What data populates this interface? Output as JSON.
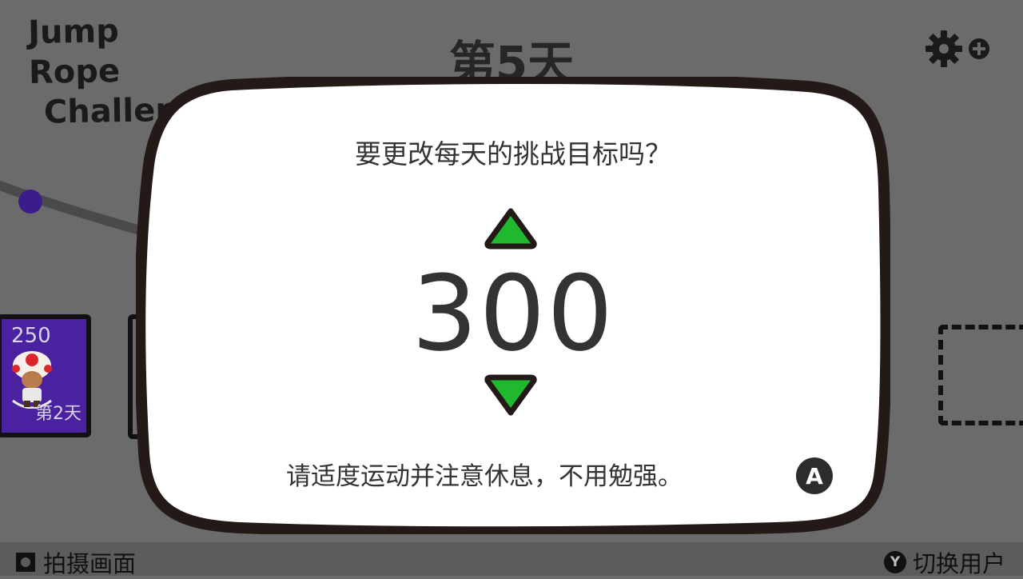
{
  "header": {
    "logo_line1": "Jump Rope",
    "logo_line2": "Challenge",
    "day_title": "第5天"
  },
  "icons": {
    "settings": "gear-icon",
    "add": "plus-circle-icon"
  },
  "cards": {
    "completed": {
      "count": "250",
      "label": "第2天"
    }
  },
  "dialog": {
    "question": "要更改每天的挑战目标吗？",
    "value": "300",
    "note": "请适度运动并注意休息，不用勉强。",
    "confirm_button": "A"
  },
  "bottom_bar": {
    "capture_label": "拍摄画面",
    "switch_user_button": "Y",
    "switch_user_label": "切换用户"
  },
  "colors": {
    "background": "#6b6b6b",
    "dialog_bg": "#ffffff",
    "dialog_border": "#231a17",
    "arrow_fill": "#1fb82e",
    "card_fill": "#4a22a0",
    "track_dot": "#3b1d8a"
  }
}
